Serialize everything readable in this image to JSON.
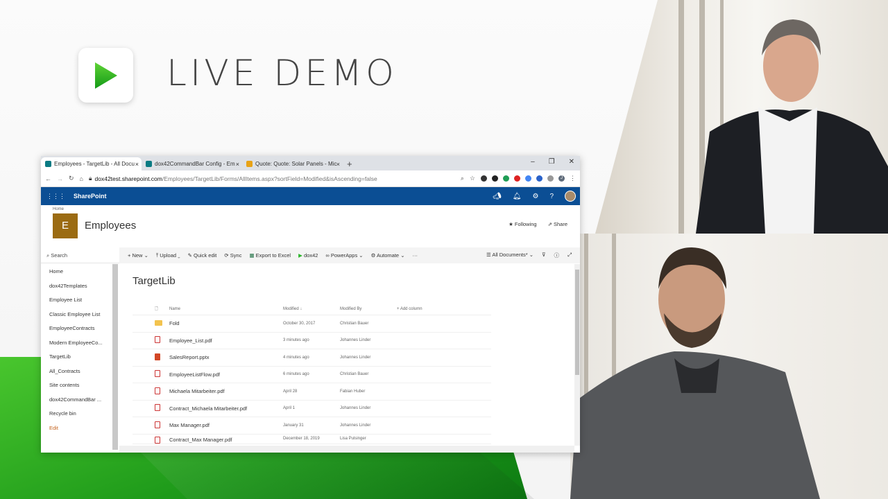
{
  "slide": {
    "title": "LIVE DEMO"
  },
  "browser": {
    "tabs": [
      {
        "label": "Employees - TargetLib - All Docu",
        "active": true
      },
      {
        "label": "dox42CommandBar Config - Em",
        "active": false
      },
      {
        "label": "Quote: Quote: Solar Panels - Mic",
        "active": false
      }
    ],
    "close_glyph": "×",
    "new_tab": "+",
    "url_host": "dox42test.sharepoint.com",
    "url_path": "/Employees/TargetLib/Forms/AllItems.aspx?sortField=Modified&isAscending=false",
    "profile_initial": "J"
  },
  "sharepoint": {
    "brand": "SharePoint",
    "breadcrumb": "Home",
    "site_initial": "E",
    "site_name": "Employees",
    "following": "Following",
    "share": "Share",
    "search_placeholder": "Search",
    "nav": [
      "Home",
      "dox42Templates",
      "Employee List",
      "Classic Employee List",
      "EmployeeContracts",
      "Modern EmployeeCo...",
      "TargetLib",
      "All_Contracts",
      "Site contents",
      "dox42CommandBar ...",
      "Recycle bin"
    ],
    "nav_edit": "Edit",
    "commands": {
      "new": "New",
      "upload": "Upload",
      "quick_edit": "Quick edit",
      "sync": "Sync",
      "export": "Export to Excel",
      "dox42": "dox42",
      "powerapps": "PowerApps",
      "automate": "Automate",
      "more": "···",
      "view": "All Documents*"
    },
    "library_title": "TargetLib",
    "columns": {
      "name": "Name",
      "modified": "Modified ↓",
      "modified_by": "Modified By",
      "add": "+ Add column"
    },
    "files": [
      {
        "type": "folder",
        "name": "Fold",
        "modified": "October 30, 2017",
        "by": "Christian Bauer"
      },
      {
        "type": "pdf",
        "name": "Employee_List.pdf",
        "modified": "3 minutes ago",
        "by": "Johannes Linder"
      },
      {
        "type": "pptx",
        "name": "SalesReport.pptx",
        "modified": "4 minutes ago",
        "by": "Johannes Linder"
      },
      {
        "type": "pdf",
        "name": "EmployeeListFlow.pdf",
        "modified": "6 minutes ago",
        "by": "Christian Bauer"
      },
      {
        "type": "pdf",
        "name": "Michaela Mitarbeiter.pdf",
        "modified": "April 28",
        "by": "Fabian Huber"
      },
      {
        "type": "pdf",
        "name": "Contract_Michaela Mitarbeiter.pdf",
        "modified": "April 1",
        "by": "Johannes Linder"
      },
      {
        "type": "pdf",
        "name": "Max Manager.pdf",
        "modified": "January 31",
        "by": "Johannes Linder"
      },
      {
        "type": "pdf",
        "name": "Contract_Max Manager.pdf",
        "modified": "December 18, 2019",
        "by": "Lisa Pulsinger"
      }
    ]
  },
  "colors": {
    "green": "#2bb52a",
    "sp_blue": "#0b4e94",
    "site_logo": "#9b6b12",
    "edit": "#c4621c"
  }
}
